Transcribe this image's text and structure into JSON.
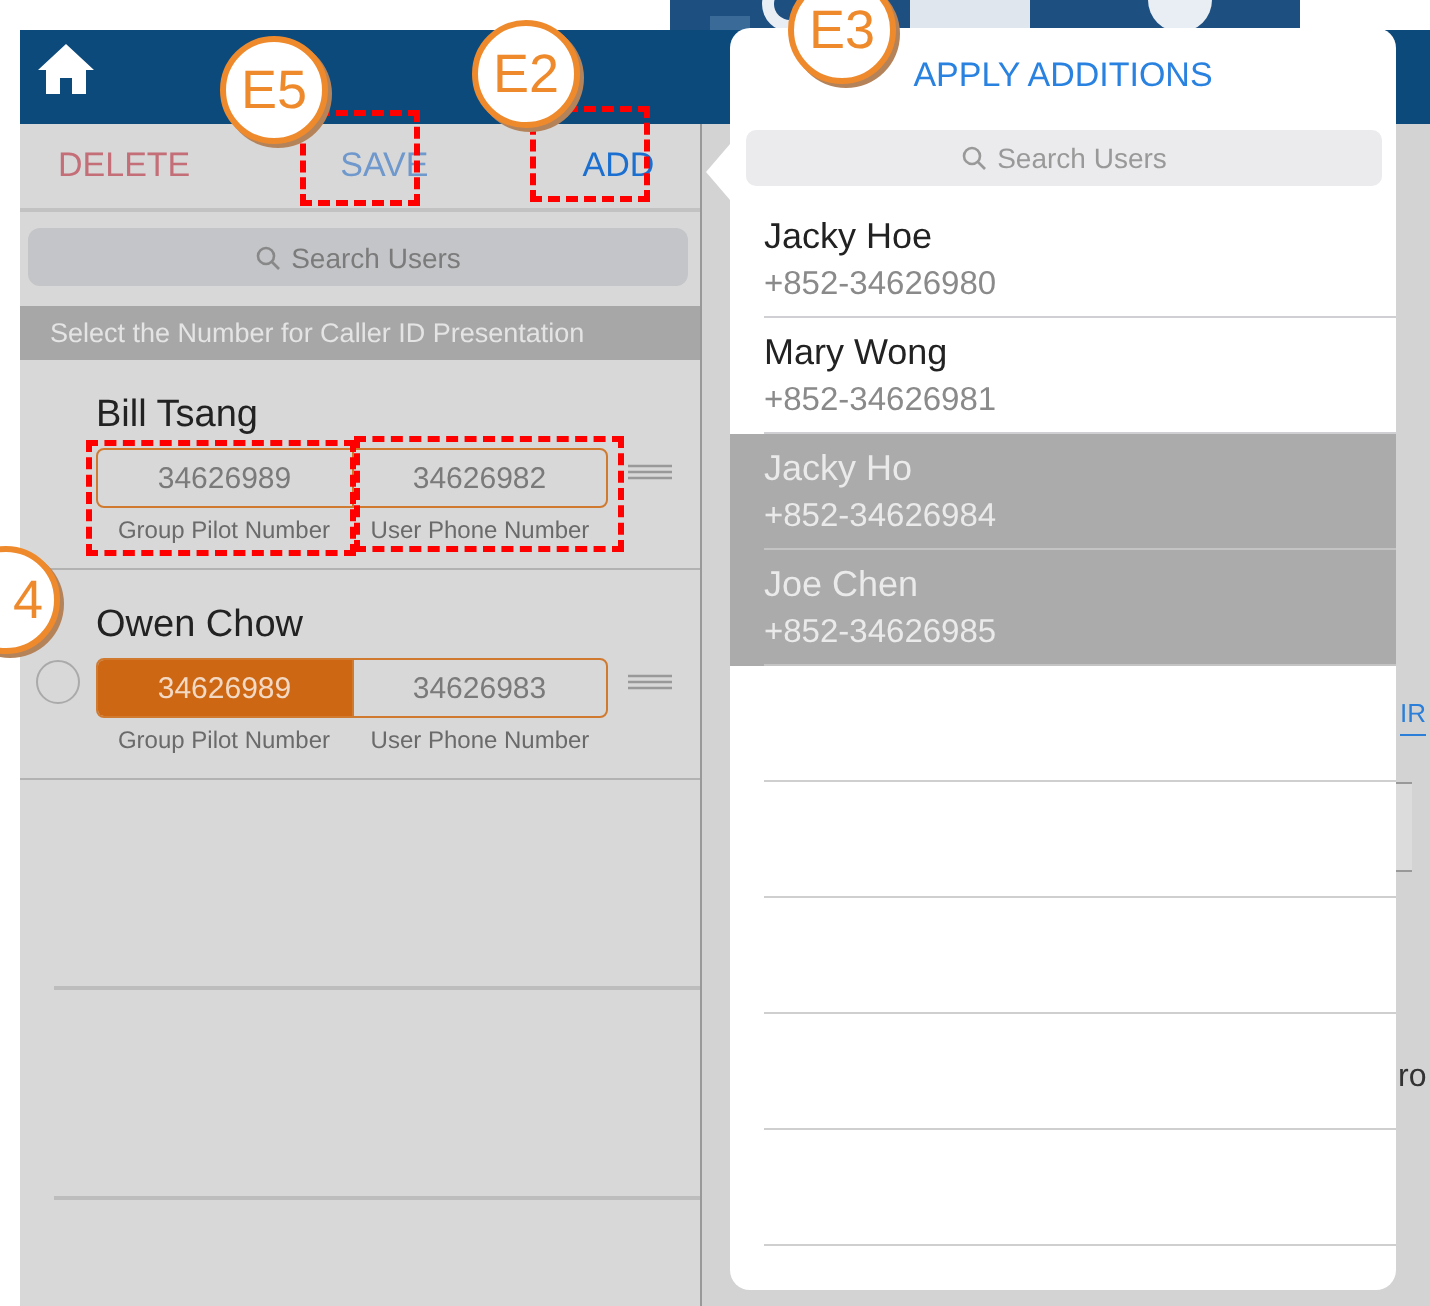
{
  "toolbar": {
    "buttons": [
      {
        "label": "DELETE",
        "kind": "delete",
        "disabled": true
      },
      {
        "label": "SAVE",
        "kind": "save",
        "disabled": true
      },
      {
        "label": "ADD",
        "kind": "add",
        "disabled": false
      }
    ]
  },
  "search": {
    "placeholder": "Search Users"
  },
  "section_header": "Select the Number for Caller ID Presentation",
  "users": [
    {
      "name": "Bill Tsang",
      "kind": "plain",
      "numbers": [
        {
          "value": "34626989",
          "caption": "Group Pilot Number",
          "selected": false
        },
        {
          "value": "34626982",
          "caption": "User Phone Number",
          "selected": false
        }
      ]
    },
    {
      "name": "Owen Chow",
      "kind": "selectable",
      "checked": false,
      "numbers": [
        {
          "value": "34626989",
          "caption": "Group Pilot Number",
          "selected": true
        },
        {
          "value": "34626983",
          "caption": "User Phone Number",
          "selected": false
        }
      ]
    }
  ],
  "popover": {
    "action": "APPLY ADDITIONS",
    "search": {
      "placeholder": "Search Users"
    },
    "contacts": [
      {
        "name": "Jacky Hoe",
        "phone": "+852-34626980",
        "selected": false
      },
      {
        "name": "Mary Wong",
        "phone": "+852-34626981",
        "selected": false
      },
      {
        "name": "Jacky Ho",
        "phone": "+852-34626984",
        "selected": true
      },
      {
        "name": "Joe Chen",
        "phone": "+852-34626985",
        "selected": true
      }
    ]
  },
  "background": {
    "texts": [
      "IR",
      "ro"
    ]
  },
  "callouts": [
    "E5",
    "E2",
    "E3",
    "4"
  ]
}
